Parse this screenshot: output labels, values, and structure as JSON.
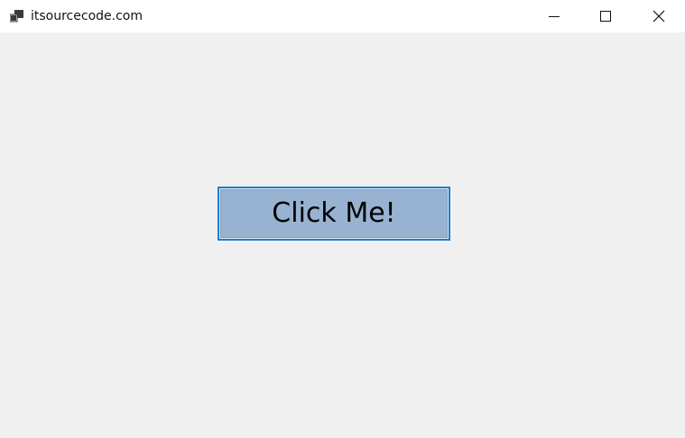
{
  "window": {
    "title": "itsourcecode.com",
    "app_icon": "app-window-icon",
    "controls": {
      "minimize_icon": "minimize-icon",
      "maximize_icon": "maximize-icon",
      "close_icon": "close-icon"
    }
  },
  "main": {
    "button_label": "Click Me!"
  },
  "colors": {
    "button_fill": "#98b3d1",
    "button_focus_border": "#1a7fd0",
    "client_background": "#f0f0f0",
    "titlebar_background": "#ffffff"
  }
}
